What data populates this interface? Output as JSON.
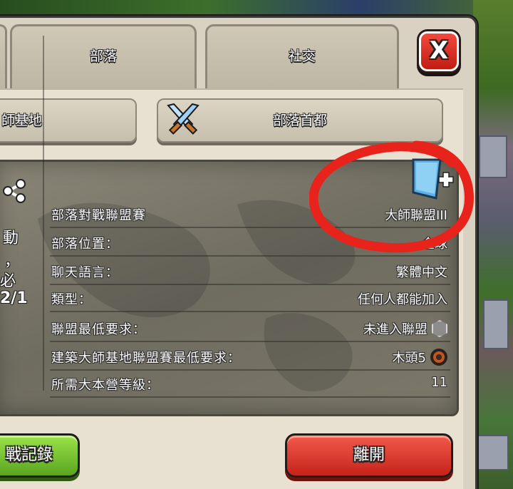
{
  "tabs": {
    "clan": "部落",
    "social": "社交"
  },
  "close_label": "X",
  "subtabs": {
    "left_partial": "師基地",
    "capital": "部落首都"
  },
  "left_panel": {
    "line1": "動",
    "line2": "，",
    "line3": "必",
    "line4": "2/1"
  },
  "rows": [
    {
      "label": "部落對戰聯盟賽",
      "value": "大師聯盟III"
    },
    {
      "label": "部落位置：",
      "value": "全球"
    },
    {
      "label": "聊天語言：",
      "value": "繁體中文"
    },
    {
      "label": "類型：",
      "value": "任何人都能加入"
    },
    {
      "label": "聯盟最低要求：",
      "value": "未進入聯盟"
    },
    {
      "label": "建築大師基地聯盟賽最低要求：",
      "value": "木頭5"
    },
    {
      "label": "所需大本營等級：",
      "value": "11"
    }
  ],
  "buttons": {
    "war_log_partial": "戰記錄",
    "leave": "離開"
  },
  "colors": {
    "leave_button": "#c6231a",
    "war_log_button": "#5aa51f",
    "annotation": "#e8231b"
  }
}
